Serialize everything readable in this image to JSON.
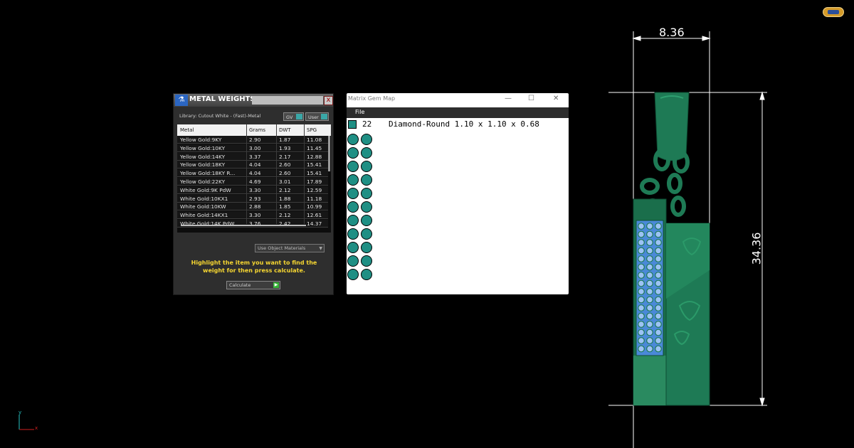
{
  "metal_weights": {
    "title": "METAL WEIGHTS",
    "close_label": "x",
    "library_label": "Library: Cutout White - (Fast)-Metal",
    "chip_gv": "GV",
    "chip_user": "User",
    "columns": [
      "Metal",
      "Grams",
      "DWT",
      "SPG"
    ],
    "rows": [
      {
        "metal": "Yellow Gold:9KY",
        "grams": "2.90",
        "dwt": "1.87",
        "spg": "11.08"
      },
      {
        "metal": "Yellow Gold:10KY",
        "grams": "3.00",
        "dwt": "1.93",
        "spg": "11.45"
      },
      {
        "metal": "Yellow Gold:14KY",
        "grams": "3.37",
        "dwt": "2.17",
        "spg": "12.88"
      },
      {
        "metal": "Yellow Gold:18KY",
        "grams": "4.04",
        "dwt": "2.60",
        "spg": "15.41"
      },
      {
        "metal": "Yellow Gold:18KY R...",
        "grams": "4.04",
        "dwt": "2.60",
        "spg": "15.41"
      },
      {
        "metal": "Yellow Gold:22KY",
        "grams": "4.69",
        "dwt": "3.01",
        "spg": "17.89"
      },
      {
        "metal": "White Gold:9K PdW",
        "grams": "3.30",
        "dwt": "2.12",
        "spg": "12.59"
      },
      {
        "metal": "White Gold:10KX1",
        "grams": "2.93",
        "dwt": "1.88",
        "spg": "11.18"
      },
      {
        "metal": "White Gold:10KW",
        "grams": "2.88",
        "dwt": "1.85",
        "spg": "10.99"
      },
      {
        "metal": "White Gold:14KX1",
        "grams": "3.30",
        "dwt": "2.12",
        "spg": "12.61"
      },
      {
        "metal": "White Gold:14K PdW",
        "grams": "3.76",
        "dwt": "2.42",
        "spg": "14.37"
      }
    ],
    "materials_select": "Use Object Materials",
    "instruction": "Highlight the item you want to find the weight for then press calculate.",
    "calculate_label": "Calculate"
  },
  "gem_map": {
    "title": "Matrix Gem Map",
    "menu_file": "File",
    "gem_count": "22",
    "gem_description": "Diamond-Round 1.10 x 1.10 x 0.68",
    "gem_color": "#1f8f84"
  },
  "dimensions": {
    "width": "8.36",
    "height": "34.36"
  },
  "axis": {
    "x": "x",
    "y": "y"
  },
  "colors": {
    "background": "#000000",
    "model_green": "#1e7a55",
    "gem_blue": "#7aa6f0",
    "instruction_yellow": "#f6d631"
  }
}
